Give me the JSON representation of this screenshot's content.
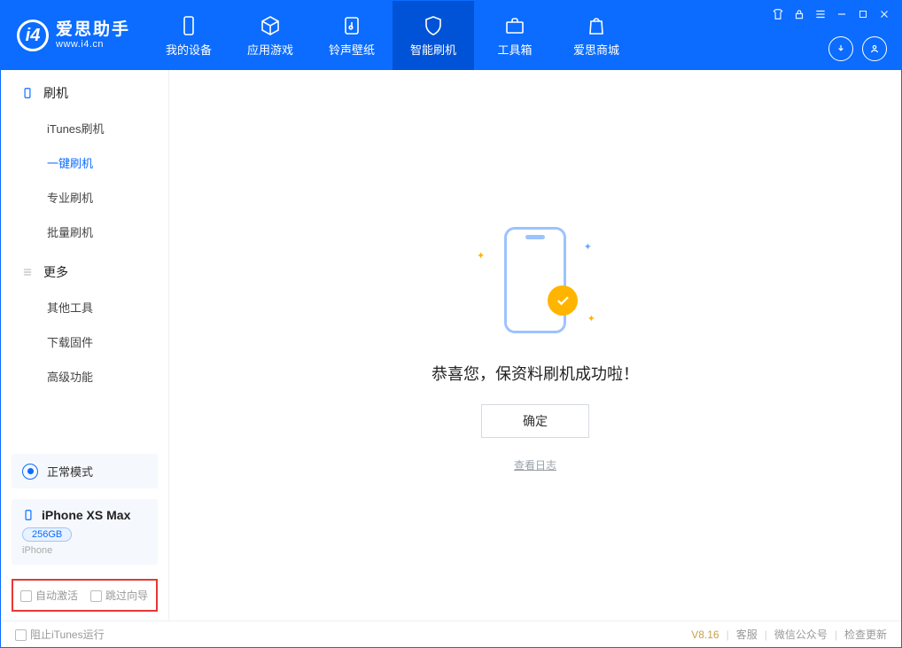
{
  "app": {
    "name": "爱思助手",
    "site": "www.i4.cn"
  },
  "nav": {
    "device": "我的设备",
    "apps": "应用游戏",
    "ring": "铃声壁纸",
    "flash": "智能刷机",
    "tools": "工具箱",
    "store": "爱思商城"
  },
  "sidebar": {
    "group_flash": "刷机",
    "items_flash": {
      "itunes": "iTunes刷机",
      "oneclick": "一键刷机",
      "pro": "专业刷机",
      "batch": "批量刷机"
    },
    "group_more": "更多",
    "items_more": {
      "other": "其他工具",
      "firmware": "下载固件",
      "advanced": "高级功能"
    }
  },
  "mode": {
    "label": "正常模式"
  },
  "device": {
    "name": "iPhone XS Max",
    "storage": "256GB",
    "type": "iPhone"
  },
  "options": {
    "auto_activate": "自动激活",
    "skip_wizard": "跳过向导"
  },
  "main": {
    "success_text": "恭喜您，保资料刷机成功啦！",
    "ok": "确定",
    "view_log": "查看日志"
  },
  "footer": {
    "block_itunes": "阻止iTunes运行",
    "version": "V8.16",
    "support": "客服",
    "wechat": "微信公众号",
    "check_update": "检查更新"
  }
}
